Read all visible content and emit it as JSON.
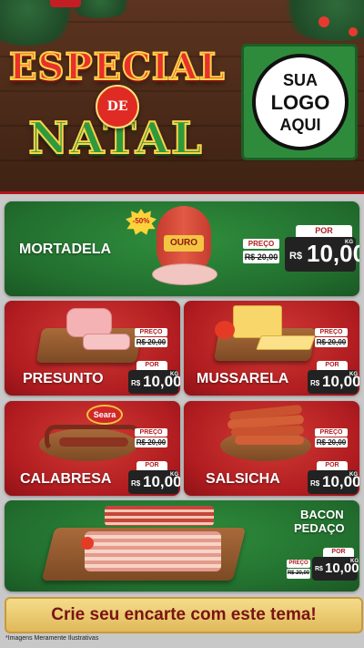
{
  "header": {
    "title_line1": "ESPECIAL",
    "title_connector": "DE",
    "title_line2": "NATAL",
    "logo_lines": [
      "SUA",
      "LOGO",
      "AQUI"
    ]
  },
  "featured_top": {
    "name": "MORTADELA",
    "brand": "OURO",
    "discount_badge": "-50%",
    "price_label": "PREÇO",
    "old_price": "R$ 20,00",
    "por_label": "POR",
    "currency": "R$",
    "price": "10,00",
    "unit": "KG"
  },
  "products": [
    {
      "name": "PRESUNTO",
      "price_label": "PREÇO",
      "old_price": "R$ 20,00",
      "por_label": "POR",
      "currency": "R$",
      "price": "10,00",
      "unit": "KG"
    },
    {
      "name": "MUSSARELA",
      "price_label": "PREÇO",
      "old_price": "R$ 20,00",
      "por_label": "POR",
      "currency": "R$",
      "price": "10,00",
      "unit": "KG"
    },
    {
      "name": "CALABRESA",
      "brand": "Seara",
      "price_label": "PREÇO",
      "old_price": "R$ 20,00",
      "por_label": "POR",
      "currency": "R$",
      "price": "10,00",
      "unit": "KG"
    },
    {
      "name": "SALSICHA",
      "price_label": "PREÇO",
      "old_price": "R$ 20,00",
      "por_label": "POR",
      "currency": "R$",
      "price": "10,00",
      "unit": "KG"
    }
  ],
  "featured_bottom": {
    "name_line1": "BACON",
    "name_line2": "PEDAÇO",
    "price_label": "PREÇO",
    "old_price": "R$ 20,00",
    "por_label": "POR",
    "currency": "R$",
    "price": "10,00",
    "unit": "KG"
  },
  "footer": {
    "cta": "Crie seu encarte com este tema!",
    "disclaimer": "*Imagens Meramente Ilustrativas"
  },
  "colors": {
    "red_card": "#b01c20",
    "green_card": "#226e2e",
    "footer_gold": "#e0b95a"
  }
}
